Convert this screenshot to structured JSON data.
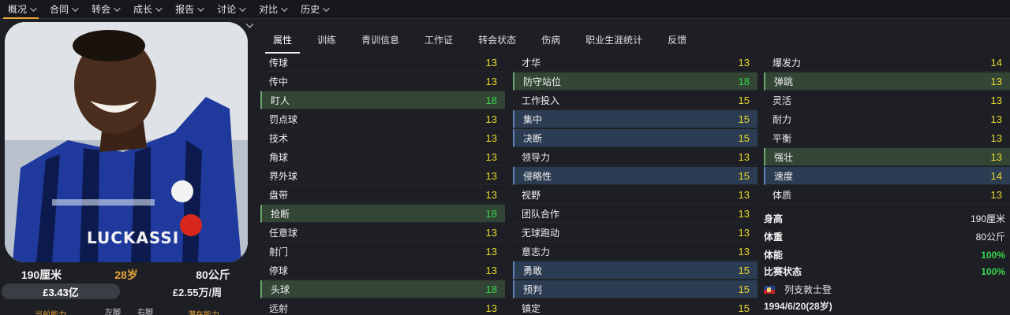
{
  "nav": [
    {
      "label": "概况"
    },
    {
      "label": "合同"
    },
    {
      "label": "转会"
    },
    {
      "label": "成长"
    },
    {
      "label": "报告"
    },
    {
      "label": "讨论"
    },
    {
      "label": "对比"
    },
    {
      "label": "历史"
    }
  ],
  "player": {
    "height": "190厘米",
    "age": "28岁",
    "weight": "80公斤",
    "value": "£3.43亿",
    "wage": "£2.55万/周",
    "shirt_name": "LUCKASSI",
    "cut_labels": {
      "current_ability": "当前能力",
      "left_foot": "左脚",
      "right_foot": "右脚",
      "potential_ability": "潜在能力"
    }
  },
  "tabs": [
    "属性",
    "训练",
    "青训信息",
    "工作证",
    "转会状态",
    "伤病",
    "职业生涯统计",
    "反馈"
  ],
  "technical": [
    {
      "name": "传球",
      "value": "13",
      "color": "y"
    },
    {
      "name": "传中",
      "value": "13",
      "color": "y"
    },
    {
      "name": "盯人",
      "value": "18",
      "color": "g",
      "hl": "green"
    },
    {
      "name": "罚点球",
      "value": "13",
      "color": "y"
    },
    {
      "name": "技术",
      "value": "13",
      "color": "y"
    },
    {
      "name": "角球",
      "value": "13",
      "color": "y"
    },
    {
      "name": "界外球",
      "value": "13",
      "color": "y"
    },
    {
      "name": "盘带",
      "value": "13",
      "color": "y"
    },
    {
      "name": "抢断",
      "value": "18",
      "color": "g",
      "hl": "green"
    },
    {
      "name": "任意球",
      "value": "13",
      "color": "y"
    },
    {
      "name": "射门",
      "value": "13",
      "color": "y"
    },
    {
      "name": "停球",
      "value": "13",
      "color": "y"
    },
    {
      "name": "头球",
      "value": "18",
      "color": "g",
      "hl": "green"
    },
    {
      "name": "远射",
      "value": "13",
      "color": "y"
    }
  ],
  "mental": [
    {
      "name": "才华",
      "value": "13",
      "color": "y"
    },
    {
      "name": "防守站位",
      "value": "18",
      "color": "g",
      "hl": "green"
    },
    {
      "name": "工作投入",
      "value": "15",
      "color": "y"
    },
    {
      "name": "集中",
      "value": "15",
      "color": "y",
      "hl": "blue"
    },
    {
      "name": "决断",
      "value": "15",
      "color": "y",
      "hl": "blue"
    },
    {
      "name": "领导力",
      "value": "13",
      "color": "y"
    },
    {
      "name": "侵略性",
      "value": "15",
      "color": "y",
      "hl": "blue"
    },
    {
      "name": "视野",
      "value": "13",
      "color": "y"
    },
    {
      "name": "团队合作",
      "value": "13",
      "color": "y"
    },
    {
      "name": "无球跑动",
      "value": "13",
      "color": "y"
    },
    {
      "name": "意志力",
      "value": "13",
      "color": "y"
    },
    {
      "name": "勇敢",
      "value": "15",
      "color": "y",
      "hl": "blue"
    },
    {
      "name": "预判",
      "value": "15",
      "color": "y",
      "hl": "blue"
    },
    {
      "name": "镇定",
      "value": "15",
      "color": "y"
    }
  ],
  "physical": [
    {
      "name": "爆发力",
      "value": "14",
      "color": "y"
    },
    {
      "name": "弹跳",
      "value": "13",
      "color": "y",
      "hl": "green"
    },
    {
      "name": "灵活",
      "value": "13",
      "color": "y"
    },
    {
      "name": "耐力",
      "value": "13",
      "color": "y"
    },
    {
      "name": "平衡",
      "value": "13",
      "color": "y"
    },
    {
      "name": "强壮",
      "value": "13",
      "color": "y",
      "hl": "green"
    },
    {
      "name": "速度",
      "value": "14",
      "color": "y",
      "hl": "blue"
    },
    {
      "name": "体质",
      "value": "13",
      "color": "y"
    }
  ],
  "info": {
    "height_label": "身高",
    "height_value": "190厘米",
    "weight_label": "体重",
    "weight_value": "80公斤",
    "fitness_label": "体能",
    "fitness_value": "100%",
    "match_label": "比赛状态",
    "match_value": "100%",
    "nation": "列支敦士登",
    "birth": "1994/6/20(28岁)"
  },
  "colors": {
    "accent": "#e8a33a",
    "good": "#39d34a",
    "ok": "#e9d82b",
    "green_hl": "#334636",
    "blue_hl": "#2c3c52"
  }
}
